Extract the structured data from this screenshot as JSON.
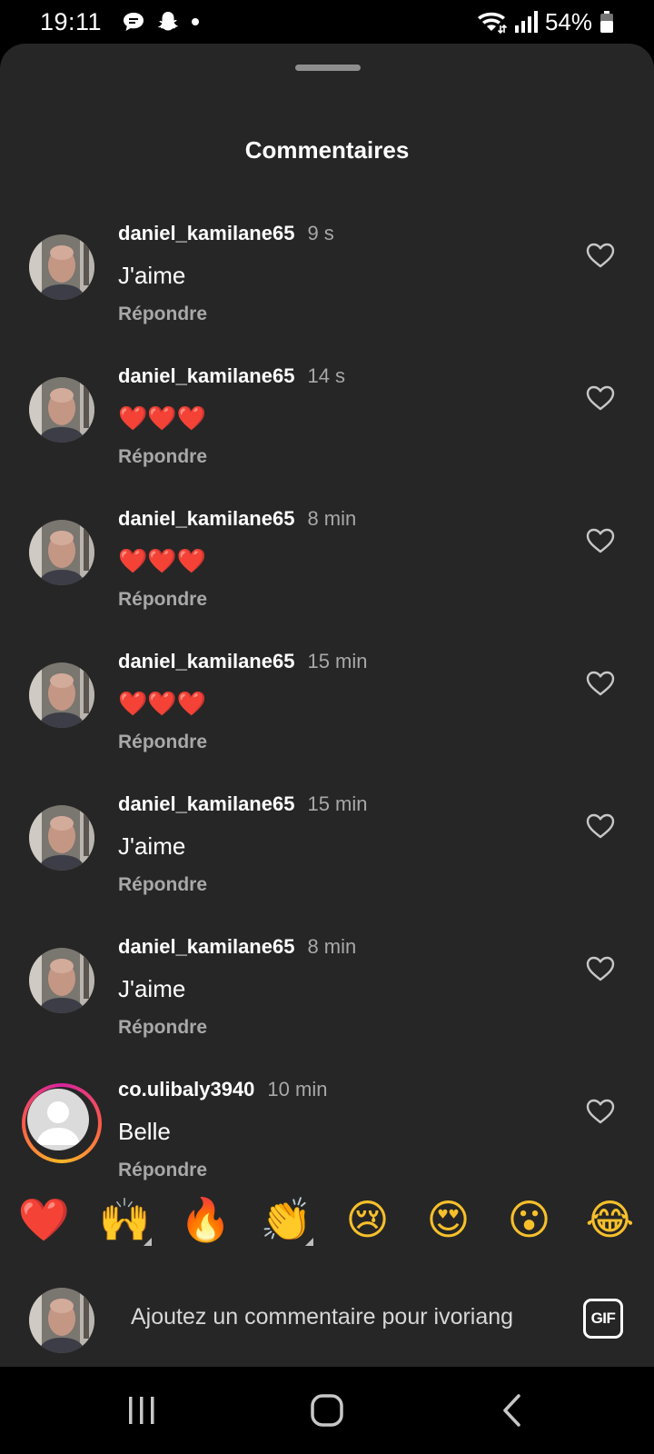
{
  "status_bar": {
    "time": "19:11",
    "battery": "54%"
  },
  "sheet": {
    "title": "Commentaires"
  },
  "comments": [
    {
      "username": "daniel_kamilane65",
      "time": "9 s",
      "text": "J'aime",
      "reply": "Répondre"
    },
    {
      "username": "daniel_kamilane65",
      "time": "14 s",
      "text": "❤️❤️❤️",
      "reply": "Répondre"
    },
    {
      "username": "daniel_kamilane65",
      "time": "8 min",
      "text": "❤️❤️❤️",
      "reply": "Répondre"
    },
    {
      "username": "daniel_kamilane65",
      "time": "15 min",
      "text": "❤️❤️❤️",
      "reply": "Répondre"
    },
    {
      "username": "daniel_kamilane65",
      "time": "15 min",
      "text": "J'aime",
      "reply": "Répondre"
    },
    {
      "username": "daniel_kamilane65",
      "time": "8 min",
      "text": "J'aime",
      "reply": "Répondre"
    },
    {
      "username": "co.ulibaly3940",
      "time": "10 min",
      "text": "Belle",
      "reply": "Répondre"
    }
  ],
  "reactions": [
    "❤️",
    "🙌",
    "🔥",
    "👏",
    "😢",
    "😍",
    "😮",
    "😂"
  ],
  "composer": {
    "placeholder": "Ajoutez un commentaire pour ivoriang",
    "gif_label": "GIF"
  },
  "colors": {
    "sheet_bg": "#262626",
    "muted_text": "#a8a8a8",
    "heart_red": "#e0245e"
  }
}
